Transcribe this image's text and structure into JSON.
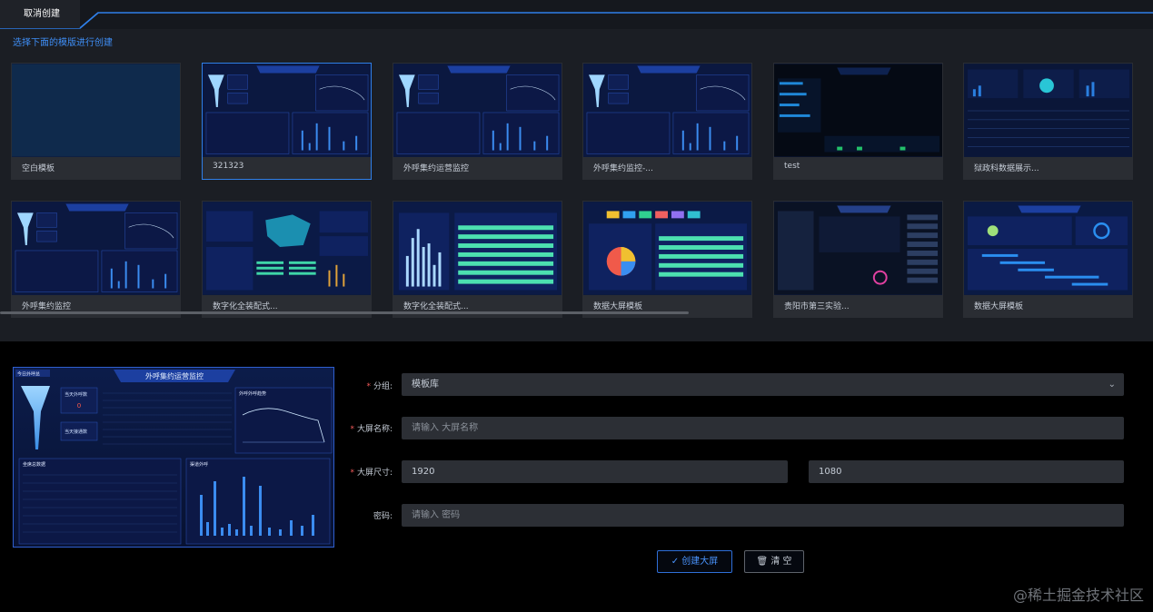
{
  "tab": {
    "label": "取消创建"
  },
  "hint": "选择下面的模版进行创建",
  "templates": [
    {
      "label": "空白模板",
      "style": "blank"
    },
    {
      "label": "321323",
      "style": "monitor"
    },
    {
      "label": "外呼集约运营监控",
      "style": "monitor"
    },
    {
      "label": "外呼集约监控-...",
      "style": "monitor"
    },
    {
      "label": "test",
      "style": "agri"
    },
    {
      "label": "狱政科数据展示...",
      "style": "stats"
    },
    {
      "label": "外呼集约监控",
      "style": "monitor"
    },
    {
      "label": "数字化全装配式...",
      "style": "map"
    },
    {
      "label": "数字化全装配式...",
      "style": "bars"
    },
    {
      "label": "数据大屏模板",
      "style": "pie"
    },
    {
      "label": "贵阳市第三实验...",
      "style": "school"
    },
    {
      "label": "数据大屏模板",
      "style": "gantt"
    }
  ],
  "preview": {
    "title": "外呼集约运营监控",
    "panel_left": "今日外呼总",
    "box1": "当天外呼数",
    "box1_value": "0",
    "box2": "当天接通数",
    "panel_trend": "外呼外呼趋势",
    "panel_bottom_left": "坐席总数据",
    "panel_bottom_right": "渠道外呼"
  },
  "form": {
    "group_label": "分组:",
    "group_value": "模板库",
    "name_label": "大屏名称:",
    "name_placeholder": "请输入 大屏名称",
    "size_label": "大屏尺寸:",
    "width": "1920",
    "height": "1080",
    "password_label": "密码:",
    "password_placeholder": "请输入 密码",
    "create_button": "✓ 创建大屏",
    "clear_button": "🗑 清 空"
  },
  "watermark": "@稀土掘金技术社区",
  "colors": {
    "accent": "#2f7fe8",
    "background": "#000000",
    "panel": "#1b1e24",
    "required": "#f25a5a"
  }
}
